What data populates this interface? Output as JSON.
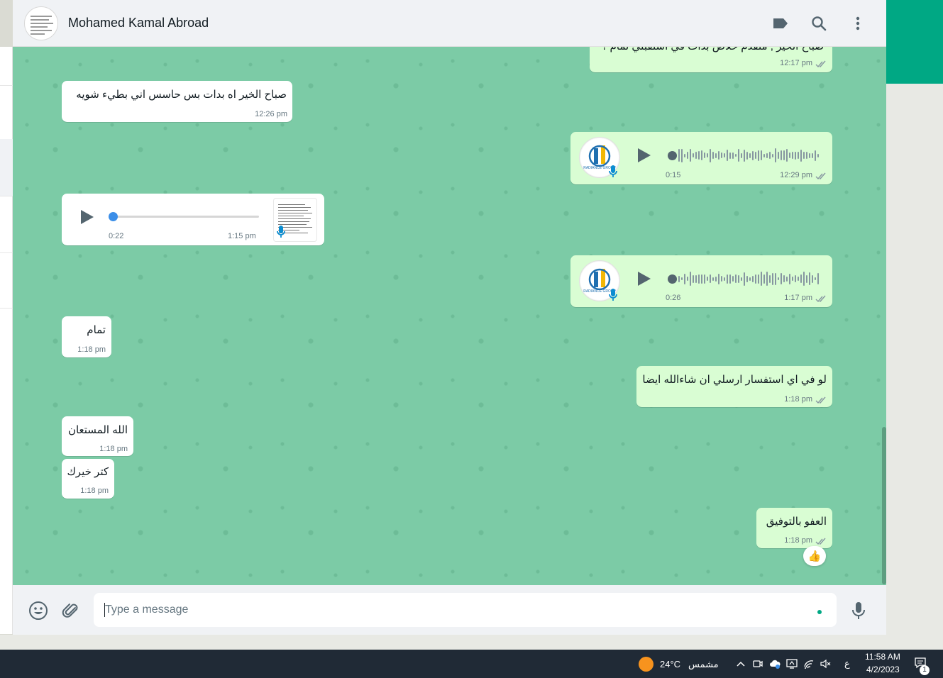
{
  "header": {
    "contact_name": "Mohamed Kamal Abroad"
  },
  "messages": [
    {
      "id": "m0",
      "direction": "out",
      "text": "صباح الخير , متقدم خلاص بدات في استقبلي تمام ؟",
      "time": "12:17 pm"
    },
    {
      "id": "m1",
      "direction": "in",
      "text": "صباح الخير  اه بدات بس حاسس اني بطيء شويه",
      "time": "12:26 pm"
    },
    {
      "id": "m2",
      "direction": "out",
      "type": "voice",
      "duration": "0:15",
      "time": "12:29 pm",
      "progress": 0
    },
    {
      "id": "m3",
      "direction": "in",
      "type": "voice",
      "duration": "0:22",
      "time": "1:15 pm",
      "progress": 0
    },
    {
      "id": "m4",
      "direction": "out",
      "type": "voice",
      "duration": "0:26",
      "time": "1:17 pm",
      "progress": 0
    },
    {
      "id": "m5",
      "direction": "in",
      "text": "تمام",
      "time": "1:18 pm"
    },
    {
      "id": "m6",
      "direction": "out",
      "text": "لو في اي استفسار ارسلي ان شاءالله ايضا",
      "time": "1:18 pm"
    },
    {
      "id": "m7",
      "direction": "in",
      "text": "الله المستعان",
      "time": "1:18 pm"
    },
    {
      "id": "m8",
      "direction": "in",
      "text": "كتر خيرك",
      "time": "1:18 pm"
    },
    {
      "id": "m9",
      "direction": "out",
      "text": "العفو بالتوفيق",
      "time": "1:18 pm",
      "reaction": "👍"
    }
  ],
  "voice_avatar_label": "RADIANCE GROUP",
  "composer": {
    "placeholder": "Type a message"
  },
  "taskbar": {
    "weather_temp": "24°C",
    "weather_text": "مشمس",
    "lang": "ع",
    "time": "11:58 AM",
    "date": "4/2/2023",
    "notification_count": "1"
  },
  "colors": {
    "chat_bg": "#7ccba6",
    "outgoing_bubble": "#d9fdd3",
    "incoming_bubble": "#ffffff",
    "accent": "#00a884",
    "voice_dot": "#3b8ee8",
    "tick": "#8696a0"
  }
}
